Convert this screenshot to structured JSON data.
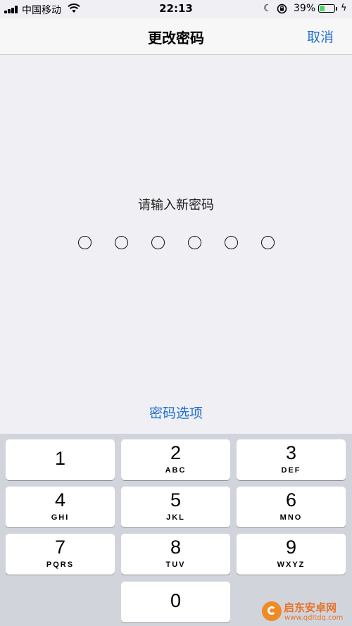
{
  "status_bar": {
    "carrier": "中国移动",
    "time": "22:13",
    "battery_percent": "39%",
    "battery_level": 0.39,
    "icons": [
      "signal-icon",
      "wifi-icon",
      "moon-icon",
      "rotation-lock-icon",
      "battery-icon",
      "charging-icon"
    ]
  },
  "nav": {
    "title": "更改密码",
    "cancel_label": "取消"
  },
  "passcode": {
    "prompt": "请输入新密码",
    "digit_count": 6,
    "options_label": "密码选项"
  },
  "keypad": {
    "keys": [
      {
        "digit": "1",
        "letters": ""
      },
      {
        "digit": "2",
        "letters": "ABC"
      },
      {
        "digit": "3",
        "letters": "DEF"
      },
      {
        "digit": "4",
        "letters": "GHI"
      },
      {
        "digit": "5",
        "letters": "JKL"
      },
      {
        "digit": "6",
        "letters": "MNO"
      },
      {
        "digit": "7",
        "letters": "PQRS"
      },
      {
        "digit": "8",
        "letters": "TUV"
      },
      {
        "digit": "9",
        "letters": "WXYZ"
      },
      {
        "digit": "0",
        "letters": ""
      }
    ]
  },
  "watermark": {
    "title": "启东安卓网",
    "url": "www.qdltdq.com"
  },
  "colors": {
    "accent": "#1f6fd0",
    "background": "#efeff4",
    "keypad_background": "#d1d5db",
    "battery_fill": "#4cd964"
  }
}
